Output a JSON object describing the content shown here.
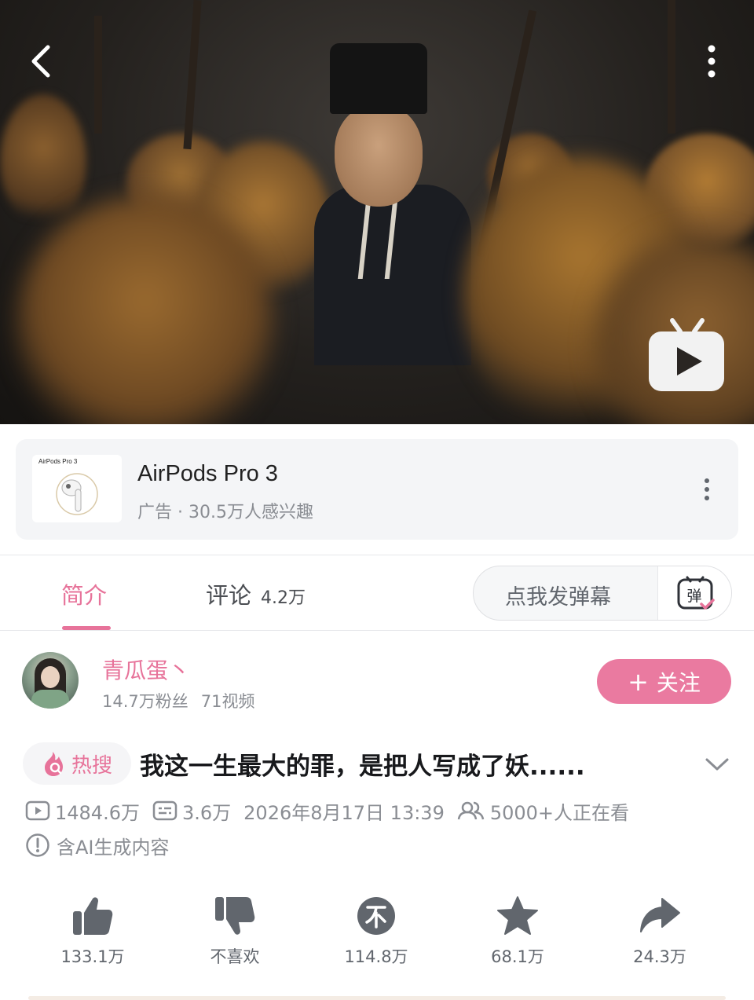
{
  "ad": {
    "product_title": "AirPods Pro 3",
    "thumb_caption": "AirPods Pro 3",
    "subtitle": "广告 · 30.5万人感兴趣"
  },
  "tabs": {
    "intro_label": "简介",
    "comments_label": "评论",
    "comments_count": "4.2万"
  },
  "danmaku": {
    "placeholder": "点我发弹幕",
    "icon_char": "弹"
  },
  "uploader": {
    "name": "青瓜蛋丶",
    "fans": "14.7万粉丝",
    "videos": "71视频",
    "follow_label": "关注"
  },
  "video": {
    "hot_label": "热搜",
    "title": "我这一生最大的罪，是把人写成了妖......",
    "views": "1484.6万",
    "danmaku_count": "3.6万",
    "publish_time": "2026年8月17日 13:39",
    "watching": "5000+人正在看",
    "ai_notice": "含AI生成内容"
  },
  "actions": {
    "like": "133.1万",
    "dislike": "不喜欢",
    "coin": "114.8万",
    "favorite": "68.1万",
    "share": "24.3万"
  },
  "colors": {
    "accent": "#e7739a",
    "follow_bg": "#ea7aa0",
    "icon_gray": "#61666d",
    "meta_gray": "#8a8d93"
  },
  "icons": [
    "back-icon",
    "more-vertical-icon",
    "tv-play-icon",
    "danmaku-icon",
    "hot-search-icon",
    "play-count-icon",
    "danmaku-count-icon",
    "watching-icon",
    "info-icon",
    "like-icon",
    "dislike-icon",
    "coin-icon",
    "favorite-icon",
    "share-icon",
    "chevron-down-icon"
  ]
}
